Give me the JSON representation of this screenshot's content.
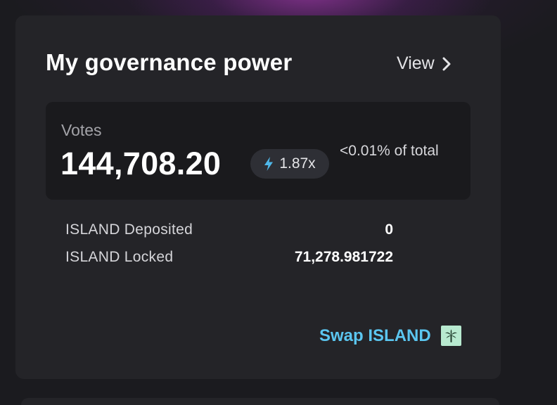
{
  "card": {
    "title": "My governance power",
    "view_label": "View"
  },
  "votes": {
    "label": "Votes",
    "value": "144,708.20",
    "multiplier": "1.87x",
    "share_of_total": "<0.01% of total"
  },
  "details": [
    {
      "label": "ISLAND Deposited",
      "value": "0"
    },
    {
      "label": "ISLAND Locked",
      "value": "71,278.981722"
    }
  ],
  "swap": {
    "label": "Swap ISLAND",
    "icon": "palm-tree-icon"
  },
  "colors": {
    "card_bg": "#242428",
    "votes_box_bg": "#1a1a1d",
    "accent_link": "#5bc6f0",
    "bolt": "#4fb8ea",
    "token_icon_bg": "#b8ead0"
  },
  "icons": {
    "view": "chevron-right-icon",
    "multiplier": "lightning-bolt-icon"
  }
}
